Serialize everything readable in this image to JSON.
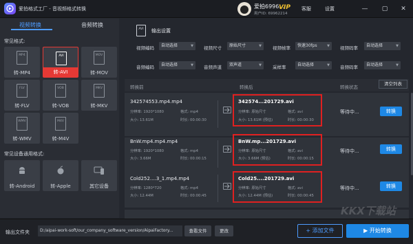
{
  "window": {
    "title": "爱拍格式工厂 - 音视频格式转换",
    "username": "爱拍6996...",
    "user_id": "用户ID: 69962214",
    "vip": "VIP",
    "service": "客服",
    "settings": "设置",
    "minimize": "—",
    "restore": "▢",
    "close": "✕"
  },
  "left": {
    "tabs": [
      "视频转换",
      "音频转换"
    ],
    "common_formats_title": "常见格式:",
    "formats": [
      {
        "icon": "MP4",
        "label": "转-MP4"
      },
      {
        "icon": "AVI",
        "label": "转-AVI"
      },
      {
        "icon": "MOV",
        "label": "转-MOV"
      },
      {
        "icon": "FLV",
        "label": "转-FLV"
      },
      {
        "icon": "VOB",
        "label": "转-VOB"
      },
      {
        "icon": "MKV",
        "label": "转-MKV"
      },
      {
        "icon": "WMV",
        "label": "转-WMV"
      },
      {
        "icon": "M4V",
        "label": "转-M4V"
      }
    ],
    "devices_title": "常见设备通用格式:",
    "devices": [
      {
        "icon": "android-icon",
        "label": "转-Android"
      },
      {
        "icon": "apple-icon",
        "label": "转-Apple"
      },
      {
        "icon": "device-icon",
        "label": "其它设备"
      }
    ]
  },
  "output": {
    "icon_text": "AVI",
    "title": "输出设置",
    "rows": [
      [
        {
          "label": "视频编码",
          "value": "自动选择"
        },
        {
          "label": "视频尺寸",
          "value": "原始尺寸"
        },
        {
          "label": "视频帧率",
          "value": "快速30fps"
        },
        {
          "label": "视频码率",
          "value": "自动选择"
        }
      ],
      [
        {
          "label": "音频编码",
          "value": "自动选择"
        },
        {
          "label": "音频声道",
          "value": "双声道"
        },
        {
          "label": "采样率",
          "value": "自动选择"
        },
        {
          "label": "音频码率",
          "value": "自动选择"
        }
      ]
    ]
  },
  "list": {
    "headers": {
      "before": "转换前",
      "after": "转换后",
      "status": "转换状态"
    },
    "clear": "清空列表",
    "items": [
      {
        "name": "342574553.mp4.mp4",
        "res": "分辨率: 1920*1080",
        "fmt": "格式: mp4",
        "size": "大小: 13.61M",
        "dur": "时长: 00:00:30",
        "out_name": "342574...201729.avi",
        "out_res": "分辨率: 原始尺寸",
        "out_fmt": "格式: avi",
        "out_size": "大小: 13.61M (预估)",
        "out_dur": "时长: 00:00:30",
        "status": "等待中...",
        "button": "转换"
      },
      {
        "name": "BnW.mp4.mp4.mp4",
        "res": "分辨率: 1920*1080",
        "fmt": "格式: mp4",
        "size": "大小: 3.66M",
        "dur": "时长: 00:00:15",
        "out_name": "BnW.mp...201729.avi",
        "out_res": "分辨率: 原始尺寸",
        "out_fmt": "格式: avi",
        "out_size": "大小: 3.66M (预估)",
        "out_dur": "时长: 00:00:15",
        "status": "等待中...",
        "button": "转换"
      },
      {
        "name": "Cold252....3_1.mp4.mp4",
        "res": "分辨率: 1280*720",
        "fmt": "格式: mp4",
        "size": "大小: 12.44M",
        "dur": "时长: 00:00:45",
        "out_name": "Cold25....201729.avi",
        "out_res": "分辨率: 原始尺寸",
        "out_fmt": "格式: avi",
        "out_size": "大小: 12.44M (预估)",
        "out_dur": "时长: 00:00:45",
        "status": "等待中...",
        "button": "转换"
      }
    ]
  },
  "bottom": {
    "outdir_label": "输出文件夹",
    "outdir": "D:/aipai-work-soft/our_company_software_version/AipaiFactory...",
    "view": "查看文件",
    "modify": "更改",
    "add": "+ 添加文件",
    "start": "▶ 开始转换"
  },
  "watermark": "KKX下载站"
}
